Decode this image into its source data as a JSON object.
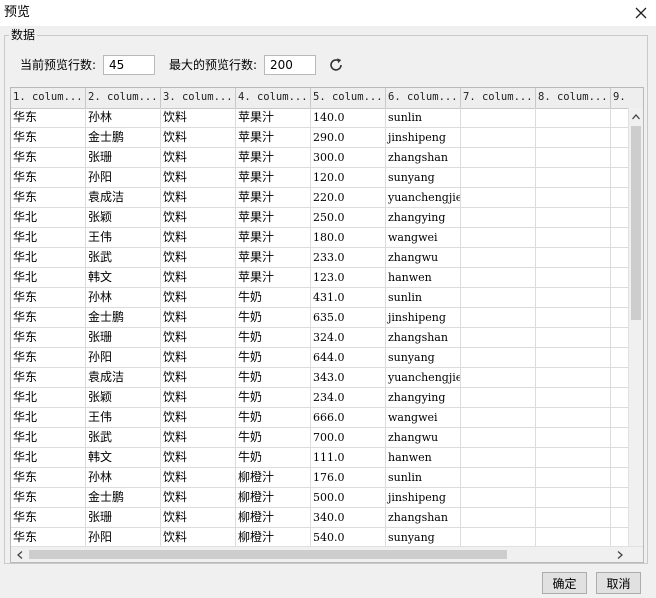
{
  "window": {
    "title": "预览"
  },
  "panel": {
    "legend": "数据",
    "current_rows_label": "当前预览行数:",
    "current_rows_value": "45",
    "max_rows_label": "最大的预览行数:",
    "max_rows_value": "200"
  },
  "grid": {
    "columns": [
      "1. colum...",
      "2. colum...",
      "3. colum...",
      "4. colum...",
      "5. colum...",
      "6. colum...",
      "7. colum...",
      "8. colum...",
      "9."
    ],
    "rows": [
      [
        "华东",
        "孙林",
        "饮料",
        "苹果汁",
        "140.0",
        "sunlin",
        "",
        ""
      ],
      [
        "华东",
        "金士鹏",
        "饮料",
        "苹果汁",
        "290.0",
        "jinshipeng",
        "",
        ""
      ],
      [
        "华东",
        "张珊",
        "饮料",
        "苹果汁",
        "300.0",
        "zhangshan",
        "",
        ""
      ],
      [
        "华东",
        "孙阳",
        "饮料",
        "苹果汁",
        "120.0",
        "sunyang",
        "",
        ""
      ],
      [
        "华东",
        "袁成洁",
        "饮料",
        "苹果汁",
        "220.0",
        "yuanchengjie",
        "",
        ""
      ],
      [
        "华北",
        "张颖",
        "饮料",
        "苹果汁",
        "250.0",
        "zhangying",
        "",
        ""
      ],
      [
        "华北",
        "王伟",
        "饮料",
        "苹果汁",
        "180.0",
        "wangwei",
        "",
        ""
      ],
      [
        "华北",
        "张武",
        "饮料",
        "苹果汁",
        "233.0",
        "zhangwu",
        "",
        ""
      ],
      [
        "华北",
        "韩文",
        "饮料",
        "苹果汁",
        "123.0",
        "hanwen",
        "",
        ""
      ],
      [
        "华东",
        "孙林",
        "饮料",
        "牛奶",
        "431.0",
        "sunlin",
        "",
        ""
      ],
      [
        "华东",
        "金士鹏",
        "饮料",
        "牛奶",
        "635.0",
        "jinshipeng",
        "",
        ""
      ],
      [
        "华东",
        "张珊",
        "饮料",
        "牛奶",
        "324.0",
        "zhangshan",
        "",
        ""
      ],
      [
        "华东",
        "孙阳",
        "饮料",
        "牛奶",
        "644.0",
        "sunyang",
        "",
        ""
      ],
      [
        "华东",
        "袁成洁",
        "饮料",
        "牛奶",
        "343.0",
        "yuanchengjie",
        "",
        ""
      ],
      [
        "华北",
        "张颖",
        "饮料",
        "牛奶",
        "234.0",
        "zhangying",
        "",
        ""
      ],
      [
        "华北",
        "王伟",
        "饮料",
        "牛奶",
        "666.0",
        "wangwei",
        "",
        ""
      ],
      [
        "华北",
        "张武",
        "饮料",
        "牛奶",
        "700.0",
        "zhangwu",
        "",
        ""
      ],
      [
        "华北",
        "韩文",
        "饮料",
        "牛奶",
        "111.0",
        "hanwen",
        "",
        ""
      ],
      [
        "华东",
        "孙林",
        "饮料",
        "柳橙汁",
        "176.0",
        "sunlin",
        "",
        ""
      ],
      [
        "华东",
        "金士鹏",
        "饮料",
        "柳橙汁",
        "500.0",
        "jinshipeng",
        "",
        ""
      ],
      [
        "华东",
        "张珊",
        "饮料",
        "柳橙汁",
        "340.0",
        "zhangshan",
        "",
        ""
      ],
      [
        "华东",
        "孙阳",
        "饮料",
        "柳橙汁",
        "540.0",
        "sunyang",
        "",
        ""
      ]
    ]
  },
  "footer": {
    "ok_label": "确定",
    "cancel_label": "取消"
  },
  "icons": {
    "close": "close-icon",
    "refresh": "refresh-icon"
  }
}
